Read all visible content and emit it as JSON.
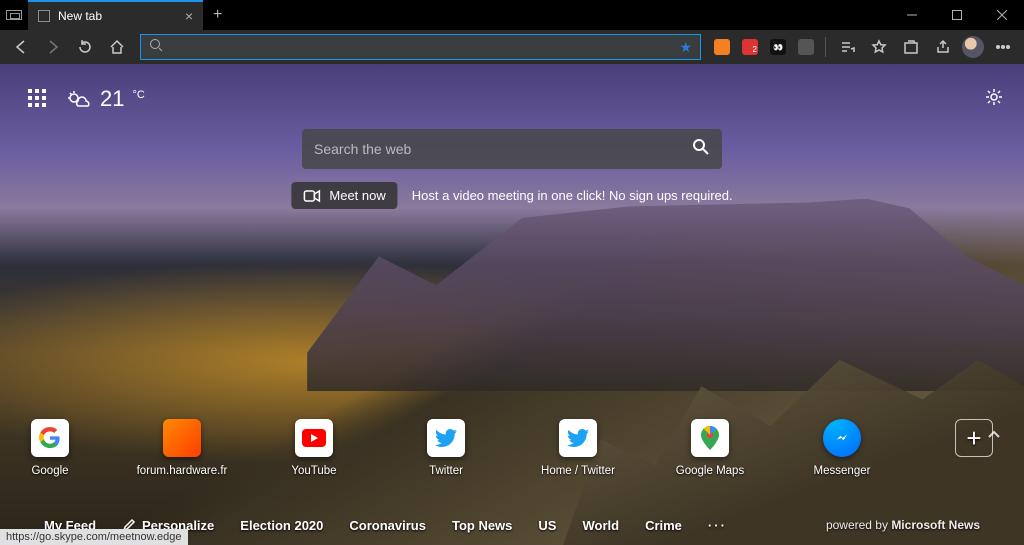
{
  "titlebar": {
    "tab_label": "New tab"
  },
  "toolbar": {
    "address_value": "",
    "ext_badge": "2"
  },
  "ntp": {
    "weather": {
      "temp": "21",
      "unit": "°C"
    },
    "search_placeholder": "Search the web",
    "meet_now_label": "Meet now",
    "meet_now_caption": "Host a video meeting in one click! No sign ups required.",
    "quick_links": [
      {
        "label": "Google"
      },
      {
        "label": "forum.hardware.fr"
      },
      {
        "label": "YouTube"
      },
      {
        "label": "Twitter"
      },
      {
        "label": "Home / Twitter"
      },
      {
        "label": "Google Maps"
      },
      {
        "label": "Messenger"
      }
    ],
    "feed": {
      "my_feed": "My Feed",
      "personalize": "Personalize",
      "links": [
        "Election 2020",
        "Coronavirus",
        "Top News",
        "US",
        "World",
        "Crime"
      ],
      "powered_by_prefix": "powered by ",
      "powered_by_brand": "Microsoft News"
    }
  },
  "status_url": "https://go.skype.com/meetnow.edge"
}
